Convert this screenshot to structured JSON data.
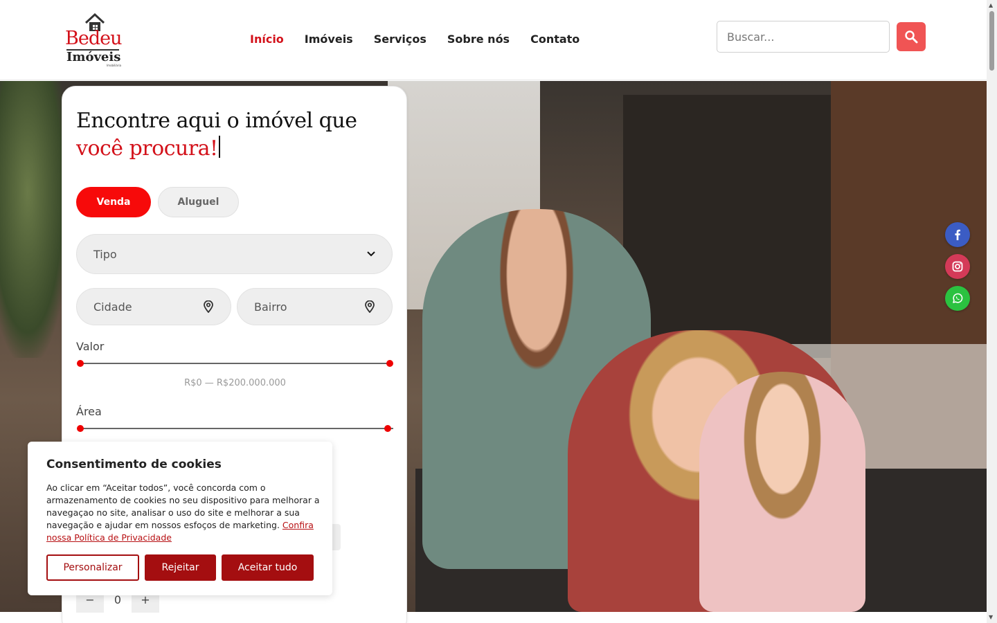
{
  "logo": {
    "line1": "Bedeu",
    "line2": "Imóveis",
    "tag": "Imobiliária"
  },
  "nav": {
    "items": [
      "Início",
      "Imóveis",
      "Serviços",
      "Sobre nós",
      "Contato"
    ],
    "active": "Início"
  },
  "search": {
    "placeholder": "Buscar..."
  },
  "hero": {
    "title_line1": "Encontre aqui o imóvel que",
    "title_line2": "você procura!",
    "tabs": [
      "Venda",
      "Aluguel"
    ],
    "tipo_label": "Tipo",
    "cidade_placeholder": "Cidade",
    "bairro_placeholder": "Bairro",
    "valor_label": "Valor",
    "valor_range": "R$0 — R$200.000.000",
    "area_label": "Área",
    "stepper_minus": "−",
    "stepper_value": "0",
    "stepper_plus": "+"
  },
  "cookie": {
    "title": "Consentimento de cookies",
    "text": " Ao clicar em “Aceitar todos”, você concorda com o armazenamento de cookies no seu dispositivo para melhorar a navegaçao no site, analisar o uso do site e melhorar a sua navegação e ajudar em nossos esfoços de marketing. ",
    "link": "Confira nossa Política de Privacidade",
    "buttons": {
      "customize": "Personalizar",
      "reject": "Rejeitar",
      "accept": "Aceitar tudo"
    }
  },
  "social": [
    "facebook-icon",
    "instagram-icon",
    "whatsapp-icon"
  ],
  "colors": {
    "brand_red": "#d3111a",
    "venda_red": "#f70a0a",
    "search_btn": "#f05454",
    "cookie_red": "#a40e10",
    "facebook": "#3b5cc4",
    "instagram": "#d43a58",
    "whatsapp": "#2bc240"
  }
}
